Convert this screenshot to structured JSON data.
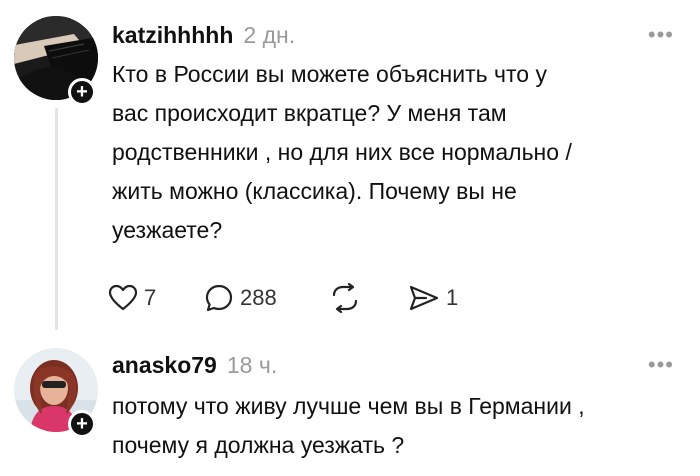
{
  "posts": [
    {
      "username": "katzihhhhh",
      "timestamp": "2 дн.",
      "more_icon": "more-icon",
      "text": "Кто в России вы можете объяснить что у\nвас происходит вкратце? У меня там\nродственники , но для них все нормально /\nжить можно (классика). Почему вы не\nуезжаете?",
      "actions": {
        "likes": "7",
        "replies": "288",
        "shares": "1"
      }
    },
    {
      "username": "anasko79",
      "timestamp": "18 ч.",
      "more_icon": "more-icon",
      "text": "потому что живу лучше чем вы в Германии ,\nпочему я должна уезжать ?"
    }
  ],
  "icons": {
    "follow": "+",
    "more": "•••"
  },
  "colors": {
    "text": "#111111",
    "muted": "#9a9a9a",
    "thread_line": "#e3e3e3"
  }
}
